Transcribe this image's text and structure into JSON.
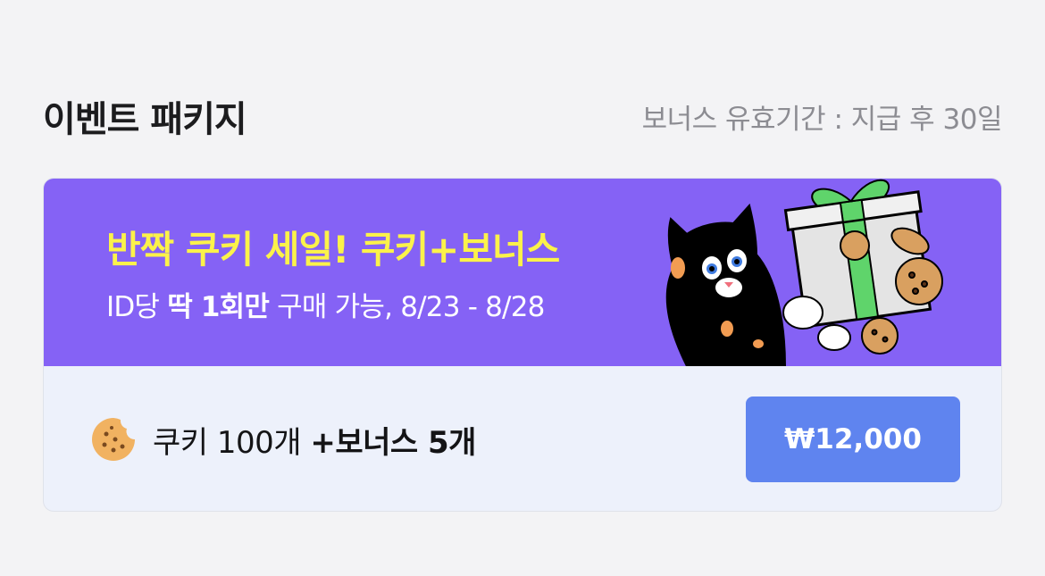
{
  "section": {
    "title": "이벤트 패키지",
    "validity": "보너스 유효기간 : 지급 후 30일"
  },
  "banner": {
    "title": "반짝 쿠키 세일! 쿠키+보너스",
    "subtitle_prefix": "ID당 ",
    "subtitle_bold": "딱 1회만",
    "subtitle_suffix": " 구매 가능, 8/23 - 8/28",
    "background_color": "#8562f5",
    "title_color": "#fbf24a",
    "art_icon": "cat-with-gift-and-cookies-illustration"
  },
  "product": {
    "icon": "cookie-icon",
    "name": "쿠키 100개 ",
    "bonus": "+보너스 5개",
    "price": "₩12,000",
    "button_color": "#5f84ef"
  }
}
